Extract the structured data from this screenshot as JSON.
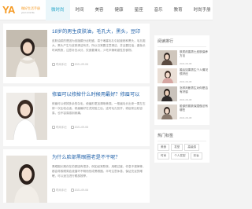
{
  "logo": {
    "mark": "YA",
    "sub": "微好生活手册",
    "en": "your mini life"
  },
  "nav": [
    {
      "label": "微时尚"
    },
    {
      "label": "时间"
    },
    {
      "label": "美容"
    },
    {
      "label": "健康"
    },
    {
      "label": "星座"
    },
    {
      "label": "音乐"
    },
    {
      "label": "教育"
    },
    {
      "label": "时尚手册"
    }
  ],
  "articles": [
    {
      "title": "18岁的男生皮肤油，毛孔大，黑头，豆印",
      "desc": "皮肤油腻的是因为皮脂腺分泌旺盛，易于堵塞毛孔引起痤疮和黑头。毛孔粗大、黑头产生与皮肤清洁有关，所以日常要注意清洁，并且要控油，避免长时间熬夜，注意补充水分，饮食要清淡，少吃辛辣刺激性的食物。",
      "category": "时尚手记",
      "date": "2021-09-08"
    },
    {
      "title": "修眉可以修掉什么时候用最好？修眉可以",
      "desc": "修眉可以修掉多余的杂毛，使眉形更加清晰美观。一般眉毛长出来一周左右修一次比较合适，修眉最好在洗完脸之后，这时毛孔张开，修起来比较容易，也不容易感到疼痛。",
      "category": "时尚手记",
      "date": "2021-09-08"
    },
    {
      "title": "为什么脸部黑眼圈老是不干呢？",
      "desc": "黑眼圈长期存在的原因有很多，例如经常熬夜、用眼过度、作息不规律等，都会导致眼周血液循环不畅而形成黑眼圈。平时注意休息，保证充足的睡眠，可以适当进行眼部按摩。",
      "category": "时尚手记",
      "date": "2021-09-08"
    }
  ],
  "sidebar": {
    "hot_title": "阅读排行",
    "hot": [
      {
        "text": "肤质改善男士皮肤保养方法",
        "date": "2021-09-08"
      },
      {
        "text": "婚后如果男生个人情况很好还",
        "date": "2021-09-08"
      },
      {
        "text": "怎样判断男生对你是否有好感",
        "date": "2021-09-08"
      },
      {
        "text": "脸部的肌肤保湿做法有哪些",
        "date": "2021-09-08"
      }
    ],
    "tags_title": "热门标签",
    "tags": [
      "美食",
      "发型",
      "高级感",
      "时尚",
      "个人发型",
      "彩妆"
    ]
  }
}
